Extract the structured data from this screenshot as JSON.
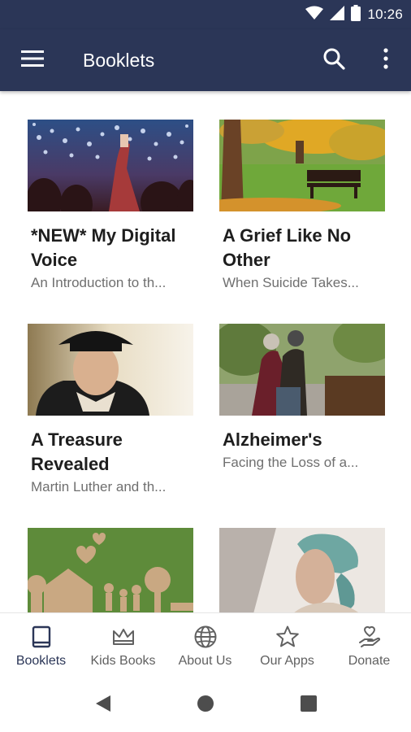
{
  "status_bar": {
    "time": "10:26"
  },
  "app_bar": {
    "title": "Booklets"
  },
  "booklets": [
    {
      "title": "*NEW* My Digital Voice",
      "subtitle": "An Introduction to th..."
    },
    {
      "title": "A Grief Like No Other",
      "subtitle": "When Suicide Takes..."
    },
    {
      "title": "A Treasure Revealed",
      "subtitle": "Martin Luther and th..."
    },
    {
      "title": "Alzheimer's",
      "subtitle": "Facing the Loss of a..."
    }
  ],
  "bottom_nav": {
    "items": [
      {
        "label": "Booklets",
        "icon": "book-icon",
        "active": true
      },
      {
        "label": "Kids Books",
        "icon": "crown-icon",
        "active": false
      },
      {
        "label": "About Us",
        "icon": "globe-icon",
        "active": false
      },
      {
        "label": "Our Apps",
        "icon": "star-icon",
        "active": false
      },
      {
        "label": "Donate",
        "icon": "heart-hand-icon",
        "active": false
      }
    ]
  },
  "colors": {
    "app_bar": "#2b3657",
    "active_nav": "#2b3657",
    "inactive_nav": "#616161"
  }
}
